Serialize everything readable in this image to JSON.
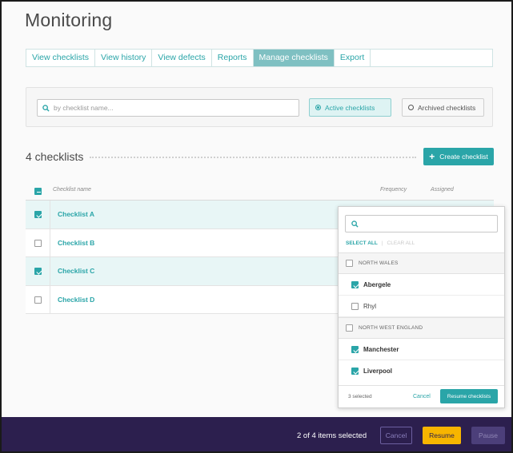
{
  "page": {
    "title": "Monitoring"
  },
  "tabs": [
    {
      "label": "View checklists",
      "active": false
    },
    {
      "label": "View history",
      "active": false
    },
    {
      "label": "View defects",
      "active": false
    },
    {
      "label": "Reports",
      "active": false
    },
    {
      "label": "Manage checklists",
      "active": true
    },
    {
      "label": "Export",
      "active": false
    }
  ],
  "filters": {
    "search_placeholder": "by checklist name...",
    "active_label": "Active checklists",
    "archived_label": "Archived checklists",
    "selected": "Active checklists"
  },
  "summary": {
    "count_label": "4 checklists",
    "create_label": "Create checklist"
  },
  "table": {
    "columns": [
      "Checklist name",
      "Frequency",
      "Assigned"
    ],
    "rows": [
      {
        "name": "Checklist A",
        "checked": true
      },
      {
        "name": "Checklist B",
        "checked": false
      },
      {
        "name": "Checklist C",
        "checked": true
      },
      {
        "name": "Checklist D",
        "checked": false
      }
    ]
  },
  "dropdown": {
    "select_all": "SELECT ALL",
    "clear_all": "CLEAR ALL",
    "groups": [
      {
        "label": "NORTH WALES",
        "items": [
          {
            "label": "Abergele",
            "checked": true
          },
          {
            "label": "Rhyl",
            "checked": false
          }
        ]
      },
      {
        "label": "NORTH WEST ENGLAND",
        "items": [
          {
            "label": "Manchester",
            "checked": true
          },
          {
            "label": "Liverpool",
            "checked": true
          }
        ]
      }
    ],
    "selected_count": "3 selected",
    "cancel_label": "Cancel",
    "resume_label": "Resume checklists"
  },
  "bottom_bar": {
    "selection_text": "2 of 4 items selected",
    "cancel_label": "Cancel",
    "resume_label": "Resume",
    "pause_label": "Pause"
  },
  "colors": {
    "accent": "#2aa5a8",
    "bar": "#2c1f4e",
    "resume": "#f7b500"
  }
}
